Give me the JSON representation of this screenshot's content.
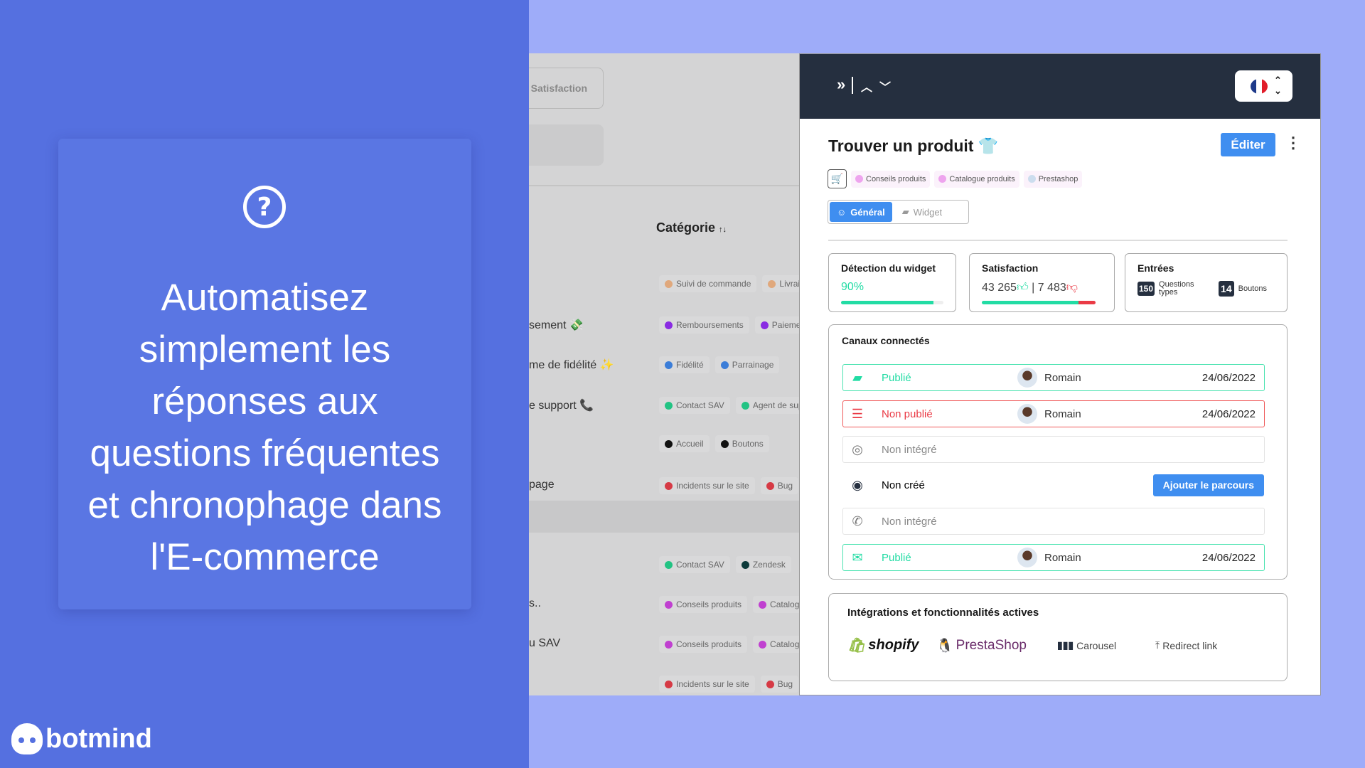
{
  "promo": {
    "headline_lines": [
      "Automatisez",
      "simplement les",
      "réponses aux",
      "questions fréquentes",
      "et chronophage dans",
      "l'E-commerce"
    ],
    "icon": "question-circle-icon",
    "brand": "botmind"
  },
  "background_app": {
    "satisfaction_button": "Satisfaction",
    "category_header": "Catégorie",
    "sort_icon": "↑↓",
    "rows": [
      {
        "label": "",
        "tags": [
          {
            "t": "Suivi de commande",
            "c": "#e0a87c"
          },
          {
            "t": "Livraiso",
            "c": "#e0a87c"
          }
        ]
      },
      {
        "label": "sement 💸",
        "tags": [
          {
            "t": "Remboursements",
            "c": "#8a2be2"
          },
          {
            "t": "Paiements",
            "c": "#8a2be2"
          }
        ]
      },
      {
        "label": "me de fidélité ✨",
        "tags": [
          {
            "t": "Fidélité",
            "c": "#3b7dd8"
          },
          {
            "t": "Parrainage",
            "c": "#3b7dd8"
          }
        ]
      },
      {
        "label": "e support 📞",
        "tags": [
          {
            "t": "Contact SAV",
            "c": "#22c383"
          },
          {
            "t": "Agent de suppo",
            "c": "#22c383"
          }
        ]
      },
      {
        "label": "",
        "tags": [
          {
            "t": "Accueil",
            "c": "#111"
          },
          {
            "t": "Boutons",
            "c": "#111"
          }
        ]
      },
      {
        "label": "page",
        "tags": [
          {
            "t": "Incidents sur le site",
            "c": "#d63a45"
          },
          {
            "t": "Bug",
            "c": "#d63a45"
          }
        ]
      },
      {
        "label": "",
        "tags": [
          {
            "t": "Contact SAV",
            "c": "#22c383"
          },
          {
            "t": "Zendesk",
            "c": "#0d3b3b"
          }
        ]
      },
      {
        "label": "s..",
        "tags": [
          {
            "t": "Conseils produits",
            "c": "#c040d0"
          },
          {
            "t": "Catalogue",
            "c": "#c040d0"
          }
        ]
      },
      {
        "label": "u SAV",
        "tags": [
          {
            "t": "Conseils produits",
            "c": "#c040d0"
          },
          {
            "t": "Catalogue",
            "c": "#c040d0"
          }
        ]
      },
      {
        "label": "",
        "tags": [
          {
            "t": "Incidents sur le site",
            "c": "#d63a45"
          },
          {
            "t": "Bug",
            "c": "#d63a45"
          }
        ]
      }
    ]
  },
  "panel": {
    "language": "FR",
    "title": "Trouver un produit",
    "title_emoji": "👕",
    "edit_label": "Éditer",
    "tags": [
      "Conseils produits",
      "Catalogue produits",
      "Prestashop"
    ],
    "tabs": [
      "Général",
      "Widget"
    ],
    "stats": {
      "detection_title": "Détection du widget",
      "detection_value": "90%",
      "detection_percent": 90,
      "satisfaction_title": "Satisfaction",
      "likes": "43 265",
      "dislikes": "| 7 483",
      "like_ratio": 85,
      "entries_title": "Entrées",
      "questions_count": "150",
      "questions_label": "Questions types",
      "buttons_count": "14",
      "buttons_label": "Boutons"
    },
    "channels_title": "Canaux connectés",
    "channels": [
      {
        "icon": "chat-icon",
        "status": "Publié",
        "user": "Romain",
        "date": "24/06/2022",
        "state": "pub"
      },
      {
        "icon": "list-icon",
        "status": "Non publié",
        "user": "Romain",
        "date": "24/06/2022",
        "state": "unp"
      },
      {
        "icon": "instagram-icon",
        "status": "Non intégré",
        "state": "ni"
      },
      {
        "icon": "messenger-icon",
        "status": "Non créé",
        "state": "nc",
        "action": "Ajouter le parcours"
      },
      {
        "icon": "whatsapp-icon",
        "status": "Non intégré",
        "state": "ni"
      },
      {
        "icon": "mail-icon",
        "status": "Publié",
        "user": "Romain",
        "date": "24/06/2022",
        "state": "pub"
      }
    ],
    "integrations_title": "Intégrations et fonctionnalités actives",
    "integrations": [
      "shopify",
      "PrestaShop",
      "Carousel",
      "Redirect link"
    ]
  },
  "colors": {
    "accent": "#3f8ef0",
    "success": "#22dca4",
    "danger": "#ea3a45",
    "header": "#252f3f",
    "promo": "#5570e0"
  }
}
